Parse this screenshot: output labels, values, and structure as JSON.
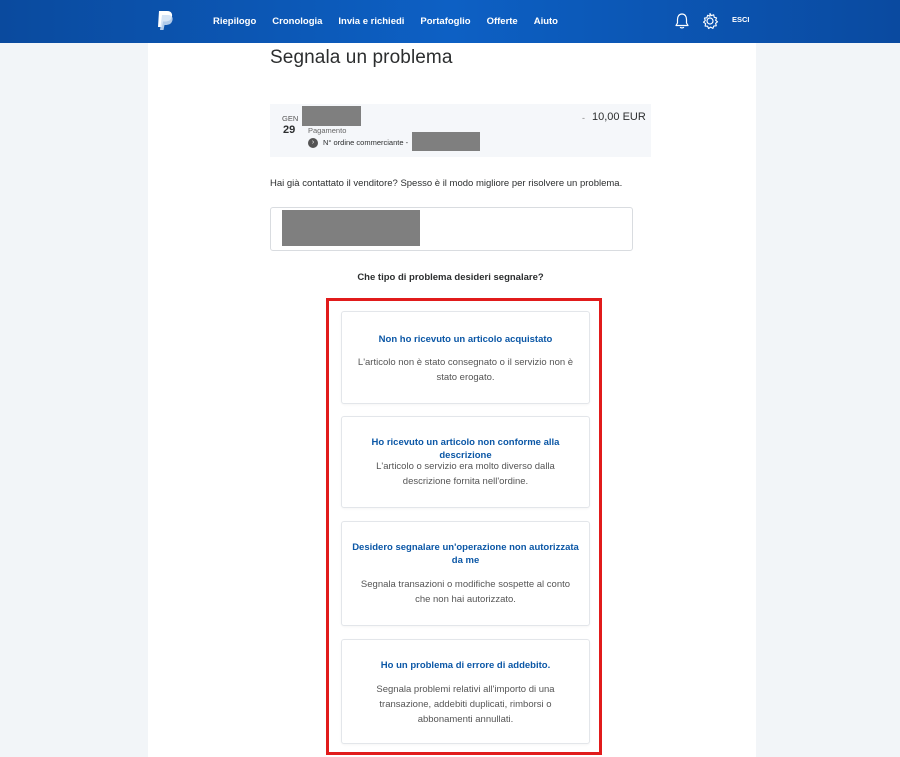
{
  "nav": {
    "items": [
      "Riepilogo",
      "Cronologia",
      "Invia e richiedi",
      "Portafoglio",
      "Offerte",
      "Aiuto"
    ],
    "logout_label": "ESCI",
    "icons": [
      "paypal-logo",
      "bell-icon",
      "gear-icon"
    ],
    "bar_color": "#0d5cbf"
  },
  "page": {
    "title": "Segnala un problema"
  },
  "transaction": {
    "month": "GEN",
    "day": "29",
    "type": "Pagamento",
    "order_label": "N° ordine commerciante -",
    "amount_sign": "-",
    "amount": "10,00 EUR"
  },
  "contact_question": "Hai già contattato il venditore? Spesso è il modo migliore per risolvere un problema.",
  "problem_question": "Che tipo di problema desideri segnalare?",
  "options": [
    {
      "title": "Non ho ricevuto un articolo acquistato",
      "description": "L'articolo non è stato consegnato o il servizio non è stato erogato."
    },
    {
      "title": "Ho ricevuto un articolo non conforme alla descrizione",
      "description": "L'articolo o servizio era molto diverso dalla descrizione fornita nell'ordine."
    },
    {
      "title": "Desidero segnalare un'operazione non autorizzata da me",
      "description": "Segnala transazioni o modifiche sospette al conto che non hai autorizzato."
    },
    {
      "title": "Ho un problema di errore di addebito.",
      "description": "Segnala problemi relativi all'importo di una transazione, addebiti duplicati, rimborsi o abbonamenti annullati."
    }
  ],
  "colors": {
    "highlight": "#e11b1b",
    "link": "#0b57a6"
  }
}
